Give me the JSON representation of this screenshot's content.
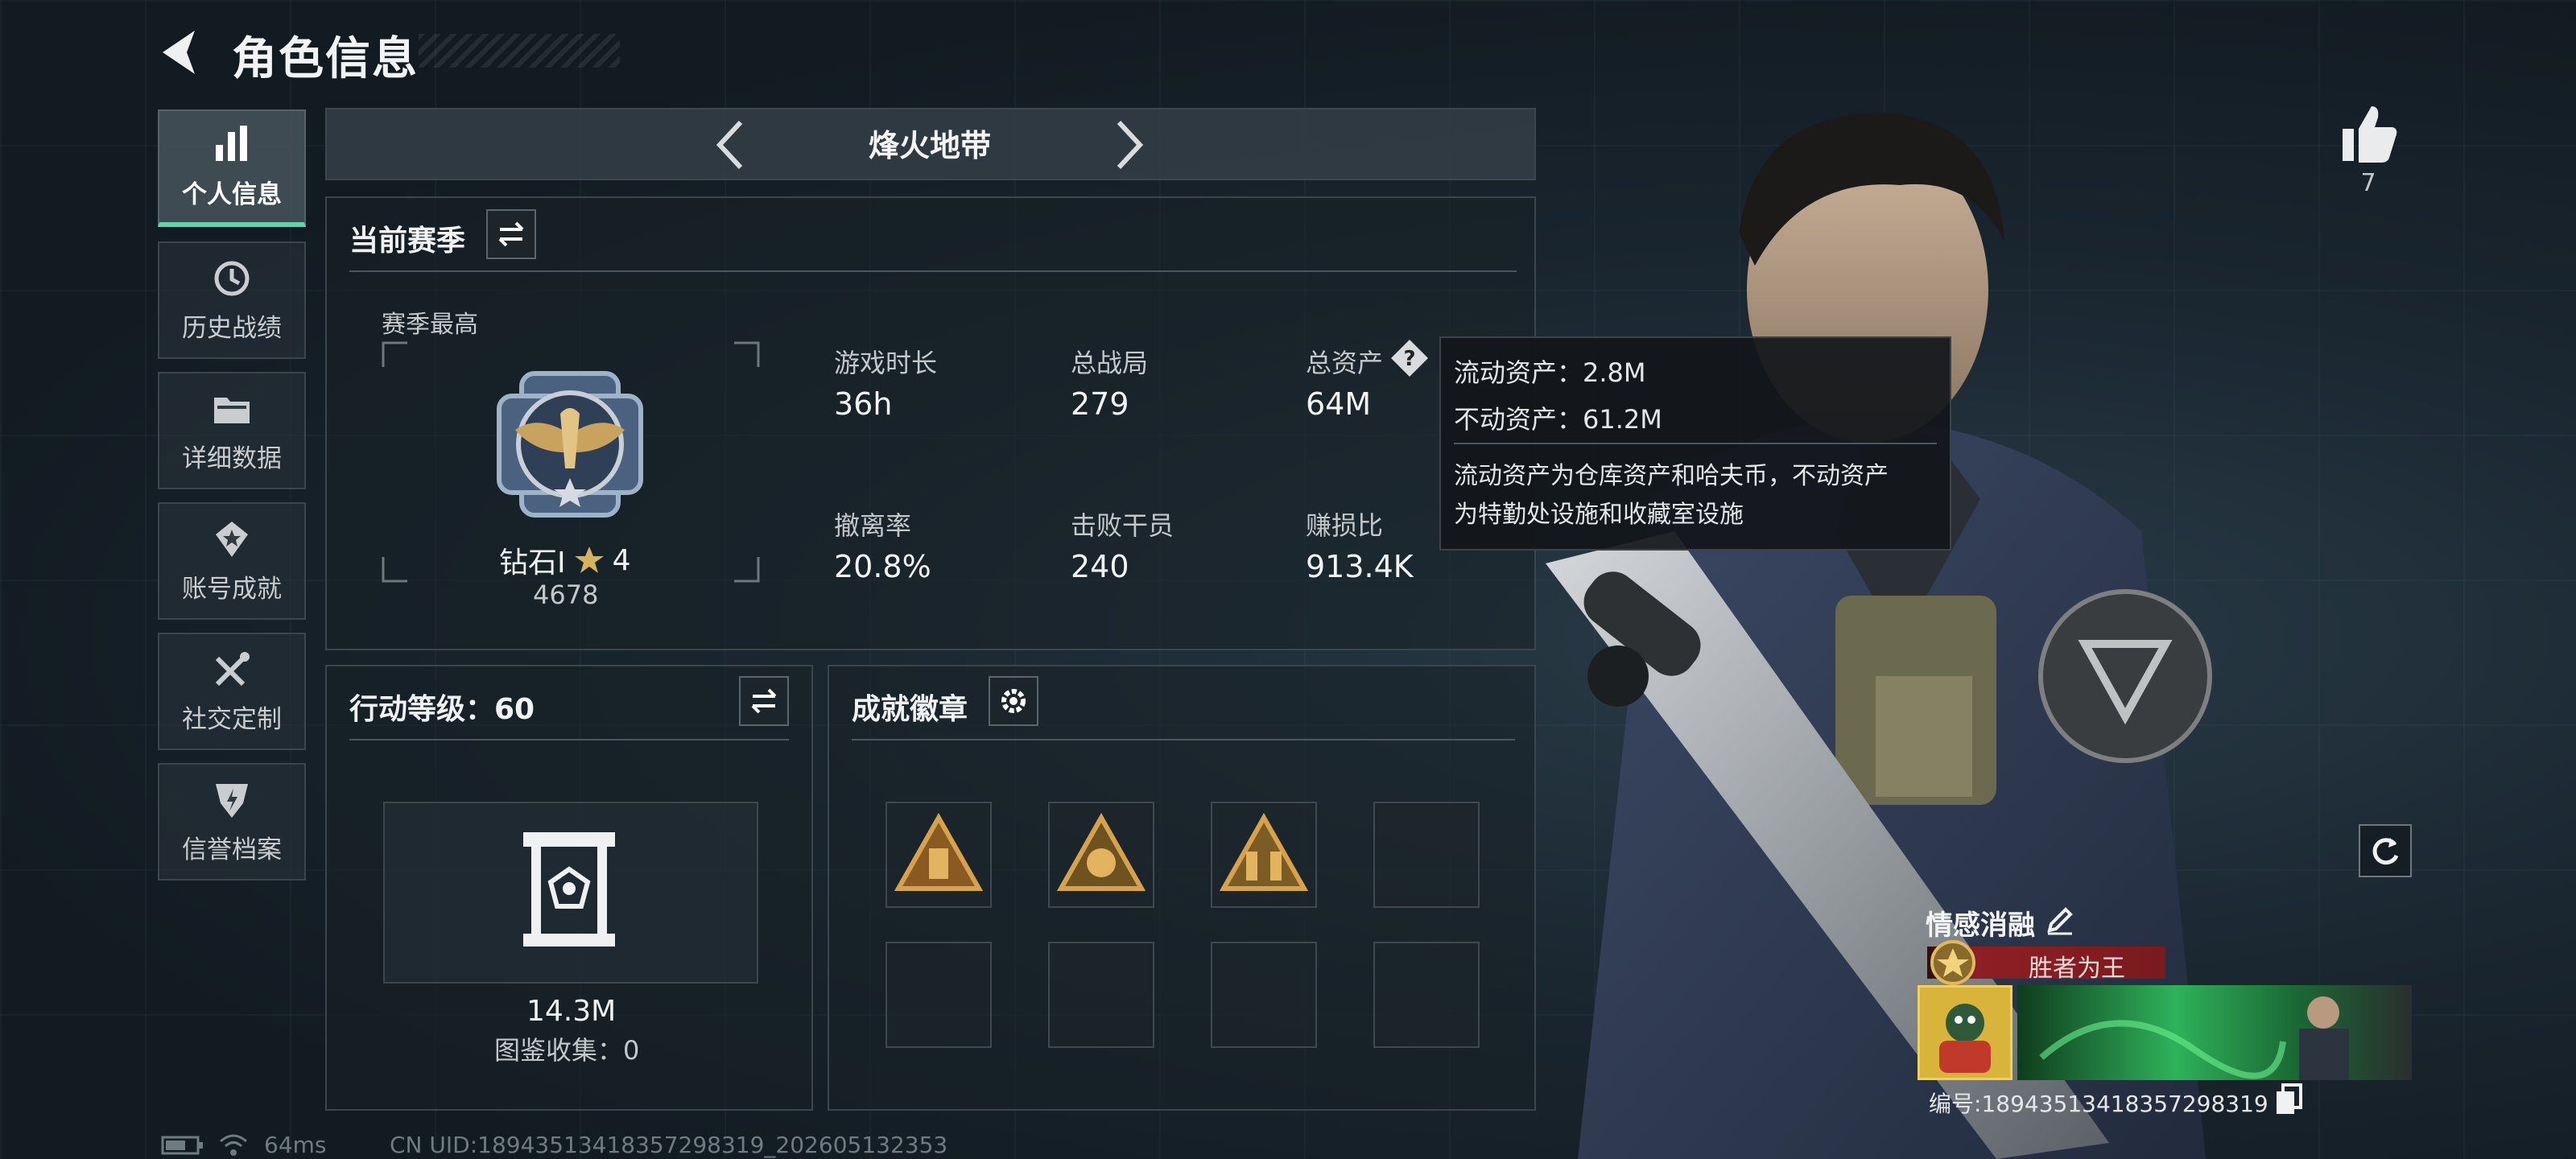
{
  "header": {
    "title": "角色信息"
  },
  "sidebar": {
    "items": [
      {
        "label": "个人信息",
        "icon": "bar-chart-icon"
      },
      {
        "label": "历史战绩",
        "icon": "history-clock-icon"
      },
      {
        "label": "详细数据",
        "icon": "folder-icon"
      },
      {
        "label": "账号成就",
        "icon": "medal-star-icon"
      },
      {
        "label": "社交定制",
        "icon": "tools-icon"
      },
      {
        "label": "信誉档案",
        "icon": "shield-bolt-icon"
      }
    ]
  },
  "mode": {
    "title": "烽火地带"
  },
  "season": {
    "title": "当前赛季",
    "best_label": "赛季最高",
    "rank_name": "钻石Ⅰ",
    "rank_stars": "4",
    "rank_points": "4678",
    "stats": [
      {
        "label": "游戏时长",
        "value": "36h"
      },
      {
        "label": "总战局",
        "value": "279"
      },
      {
        "label": "总资产",
        "value": "64M"
      },
      {
        "label": "撤离率",
        "value": "20.8%"
      },
      {
        "label": "击败干员",
        "value": "240"
      },
      {
        "label": "赚损比",
        "value": "913.4K"
      }
    ]
  },
  "tooltip": {
    "liquid": "流动资产：2.8M",
    "fixed": "不动资产：61.2M",
    "desc1": "流动资产为仓库资产和哈夫币，不动资产",
    "desc2": "为特勤处设施和收藏室设施"
  },
  "action_level": {
    "title": "行动等级：60",
    "collection_value": "14.3M",
    "collection_label": "图鉴收集：0"
  },
  "achievements": {
    "title": "成就徽章"
  },
  "likes": {
    "count": "7"
  },
  "profile": {
    "name": "情感消融",
    "title_badge": "胜者为王",
    "id_text": "编号:18943513418357298319"
  },
  "footer": {
    "ping": "64ms",
    "uid": "CN UID:18943513418357298319_202605132353"
  },
  "colors": {
    "accent": "#5fd6a9",
    "title_badge_bg": "#8e1f24"
  }
}
